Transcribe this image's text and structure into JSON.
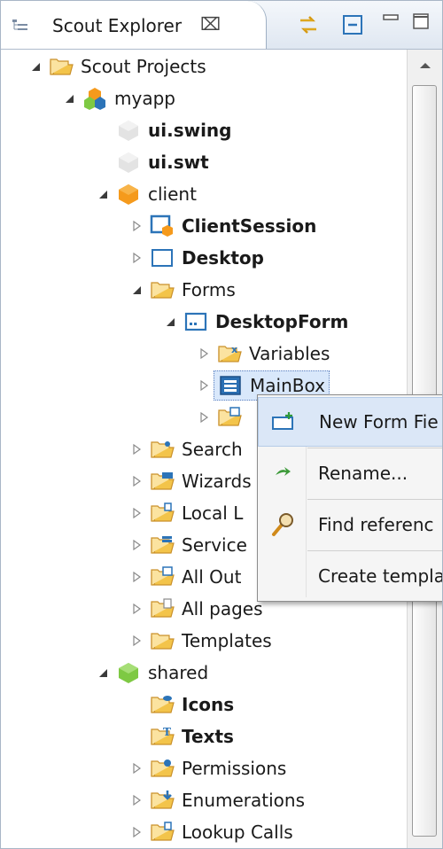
{
  "view": {
    "title": "Scout Explorer",
    "close_glyph": "⌧",
    "toolbar_icons": [
      "link-with-editor-icon",
      "collapse-all-icon",
      "minimize-icon",
      "maximize-icon"
    ]
  },
  "tree": [
    {
      "label": "Scout Projects",
      "level": 0,
      "arrow": "expanded",
      "icon": "folder-open-icon",
      "bold": false
    },
    {
      "label": "myapp",
      "level": 1,
      "arrow": "expanded",
      "icon": "project-icon",
      "bold": false
    },
    {
      "label": "ui.swing",
      "level": 2,
      "arrow": "none",
      "icon": "ui-bundle-icon",
      "bold": true
    },
    {
      "label": "ui.swt",
      "level": 2,
      "arrow": "none",
      "icon": "ui-bundle-icon",
      "bold": true
    },
    {
      "label": "client",
      "level": 2,
      "arrow": "expanded",
      "icon": "client-bundle-icon",
      "bold": false
    },
    {
      "label": "ClientSession",
      "level": 3,
      "arrow": "collapsed",
      "icon": "client-session-icon",
      "bold": true
    },
    {
      "label": "Desktop",
      "level": 3,
      "arrow": "collapsed",
      "icon": "desktop-icon",
      "bold": true
    },
    {
      "label": "Forms",
      "level": 3,
      "arrow": "expanded",
      "icon": "folder-open-icon",
      "bold": false
    },
    {
      "label": "DesktopForm",
      "level": 4,
      "arrow": "expanded",
      "icon": "form-icon",
      "bold": true
    },
    {
      "label": "Variables",
      "level": 5,
      "arrow": "collapsed",
      "icon": "variables-folder-icon",
      "bold": false
    },
    {
      "label": "MainBox",
      "level": 5,
      "arrow": "collapsed",
      "icon": "mainbox-icon",
      "bold": false,
      "selected": true
    },
    {
      "label": "",
      "level": 5,
      "arrow": "collapsed",
      "icon": "handlers-folder-icon",
      "bold": false
    },
    {
      "label": "Search",
      "level": 3,
      "arrow": "collapsed",
      "icon": "search-folder-icon",
      "bold": false
    },
    {
      "label": "Wizards",
      "level": 3,
      "arrow": "collapsed",
      "icon": "wizards-folder-icon",
      "bold": false
    },
    {
      "label": "Local L",
      "level": 3,
      "arrow": "collapsed",
      "icon": "lookup-folder-icon",
      "bold": false
    },
    {
      "label": "Service",
      "level": 3,
      "arrow": "collapsed",
      "icon": "services-folder-icon",
      "bold": false
    },
    {
      "label": "All Out",
      "level": 3,
      "arrow": "collapsed",
      "icon": "outlines-folder-icon",
      "bold": false
    },
    {
      "label": "All pages",
      "level": 3,
      "arrow": "collapsed",
      "icon": "pages-folder-icon",
      "bold": false
    },
    {
      "label": "Templates",
      "level": 3,
      "arrow": "collapsed",
      "icon": "folder-open-icon",
      "bold": false
    },
    {
      "label": "shared",
      "level": 2,
      "arrow": "expanded",
      "icon": "shared-bundle-icon",
      "bold": false
    },
    {
      "label": "Icons",
      "level": 3,
      "arrow": "none",
      "icon": "icons-folder-icon",
      "bold": true
    },
    {
      "label": "Texts",
      "level": 3,
      "arrow": "none",
      "icon": "texts-folder-icon",
      "bold": true
    },
    {
      "label": "Permissions",
      "level": 3,
      "arrow": "collapsed",
      "icon": "permissions-folder-icon",
      "bold": false
    },
    {
      "label": "Enumerations",
      "level": 3,
      "arrow": "collapsed",
      "icon": "enumerations-folder-icon",
      "bold": false
    },
    {
      "label": "Lookup Calls",
      "level": 3,
      "arrow": "collapsed",
      "icon": "lookup-folder-icon",
      "bold": false
    }
  ],
  "context_menu": {
    "items": [
      {
        "label": "New Form Fie",
        "icon": "new-form-field-icon",
        "hover": true
      },
      {
        "label": "Rename...",
        "icon": "rename-icon",
        "hover": false
      },
      {
        "label": "Find referenc",
        "icon": "find-references-icon",
        "hover": false
      },
      {
        "label": "Create templa",
        "icon": "",
        "hover": false
      }
    ]
  },
  "colors": {
    "folder": "#f3c44a",
    "folder_dark": "#c9902a",
    "accent_blue": "#2c74b8",
    "selection": "#d9e8fb",
    "client_orange": "#f59a1c",
    "shared_green": "#7ec943"
  }
}
